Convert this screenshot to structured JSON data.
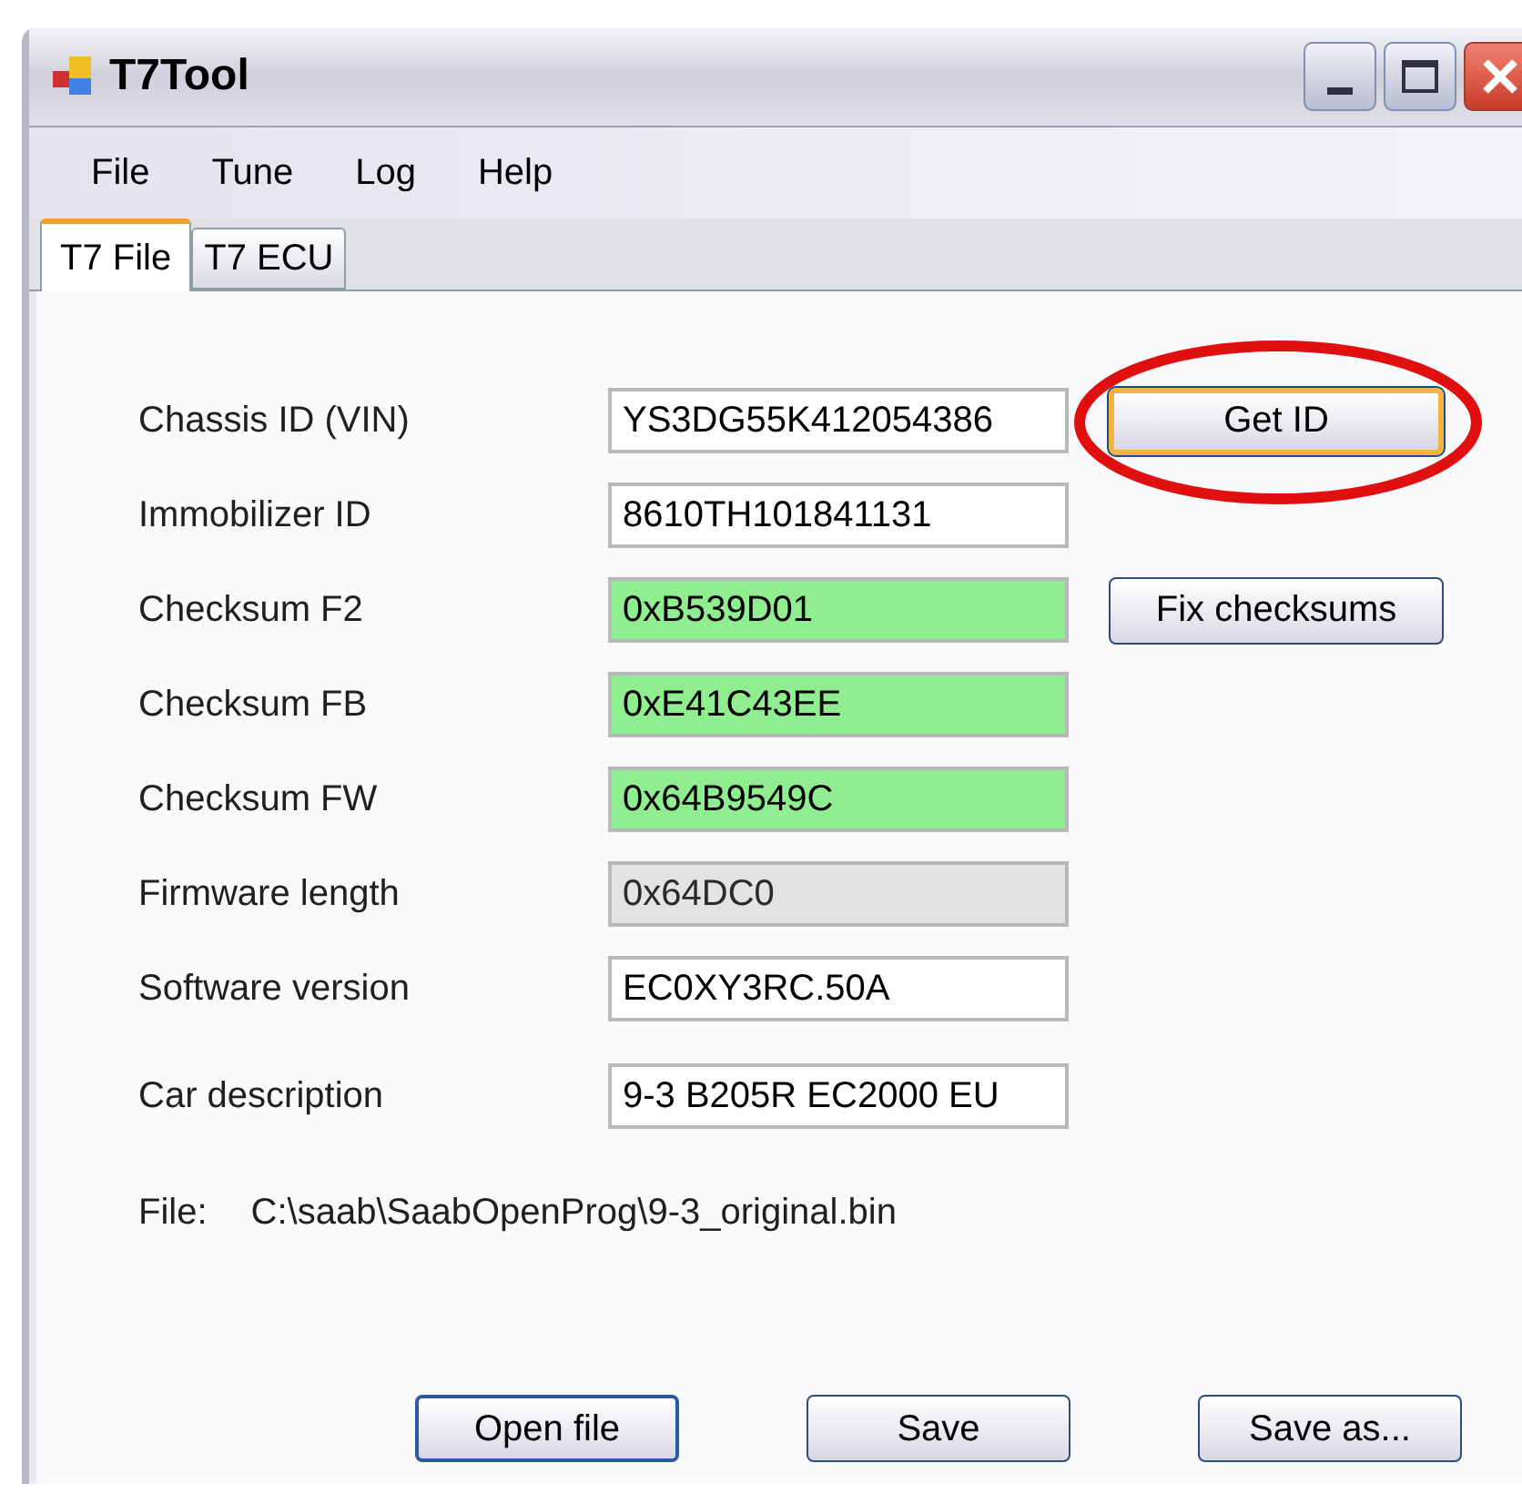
{
  "window": {
    "title": "T7Tool"
  },
  "menu": [
    "File",
    "Tune",
    "Log",
    "Help"
  ],
  "tabs": [
    {
      "label": "T7 File",
      "selected": true
    },
    {
      "label": "T7 ECU",
      "selected": false
    }
  ],
  "fields": [
    {
      "label": "Chassis ID (VIN)",
      "value": "YS3DG55K412054386",
      "valid": false,
      "readonly": false,
      "button": {
        "label": "Get ID",
        "focused": true,
        "highlighted": true
      }
    },
    {
      "label": "Immobilizer ID",
      "value": "8610TH101841131",
      "valid": false,
      "readonly": false
    },
    {
      "label": "Checksum F2",
      "value": "0xB539D01",
      "valid": true,
      "readonly": false,
      "button": {
        "label": "Fix checksums",
        "focused": false,
        "highlighted": false
      }
    },
    {
      "label": "Checksum FB",
      "value": "0xE41C43EE",
      "valid": true,
      "readonly": false
    },
    {
      "label": "Checksum FW",
      "value": "0x64B9549C",
      "valid": true,
      "readonly": false
    },
    {
      "label": "Firmware length",
      "value": "0x64DC0",
      "valid": false,
      "readonly": true
    },
    {
      "label": "Software version",
      "value": "EC0XY3RC.50A",
      "valid": false,
      "readonly": false
    },
    {
      "label": "Car description",
      "value": "9-3 B205R EC2000 EU",
      "valid": false,
      "readonly": false
    }
  ],
  "file": {
    "label": "File:",
    "path": "C:\\saab\\SaabOpenProg\\9-3_original.bin"
  },
  "buttons": [
    {
      "label": "Open file",
      "default": true
    },
    {
      "label": "Save",
      "default": false
    },
    {
      "label": "Save as...",
      "default": false
    }
  ]
}
